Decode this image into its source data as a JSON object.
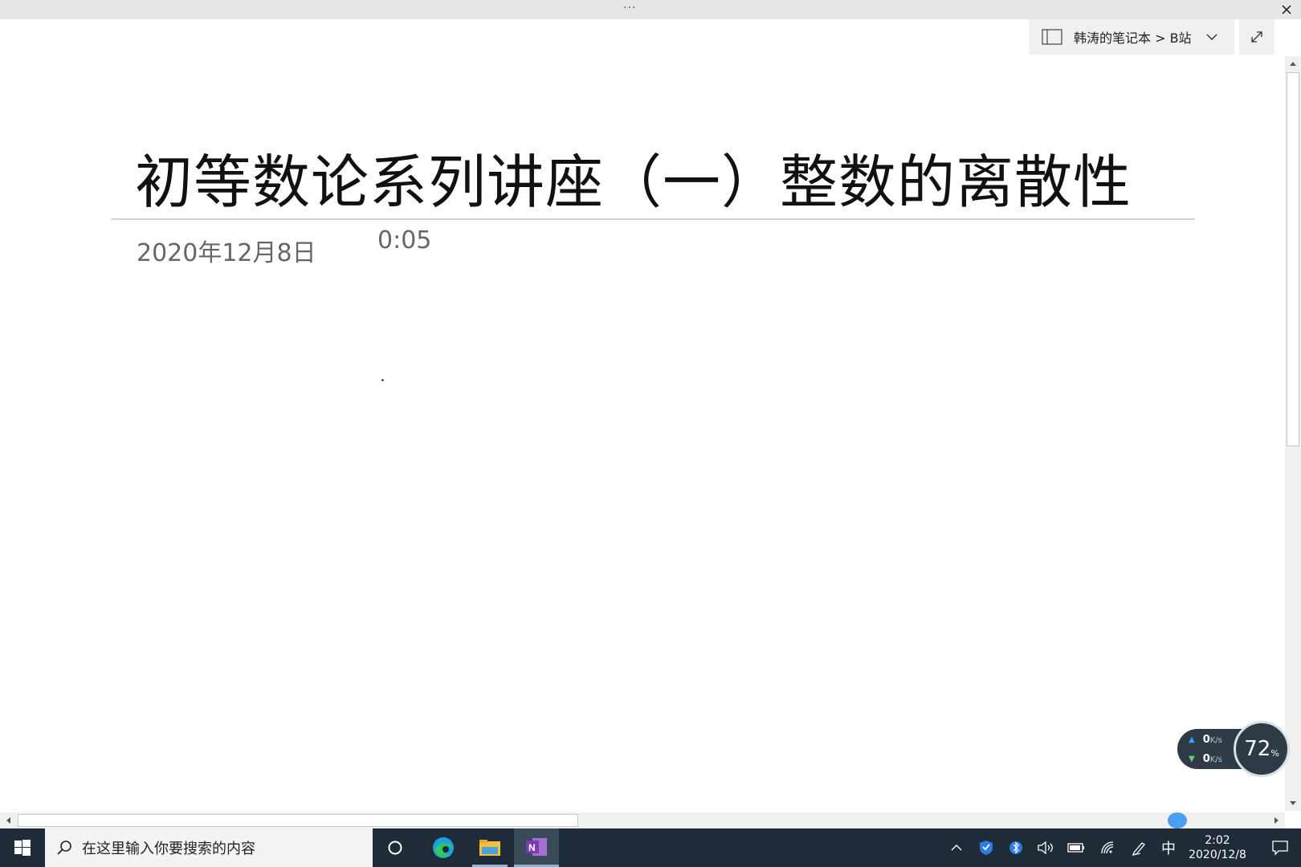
{
  "window": {
    "more_glyph": "···",
    "close_glyph": "✕"
  },
  "breadcrumb": {
    "text": "韩涛的笔记本 > B站"
  },
  "page": {
    "title": "初等数论系列讲座（一）整数的离散性",
    "date": "2020年12月8日",
    "time": "0:05"
  },
  "net_widget": {
    "upload_value": "0",
    "upload_unit": "K/s",
    "download_value": "0",
    "download_unit": "K/s",
    "cpu_value": "72",
    "cpu_unit": "%"
  },
  "taskbar": {
    "search_placeholder": "在这里输入你要搜索的内容",
    "apps": [
      "cortana-icon",
      "edge-icon",
      "file-explorer-icon",
      "onenote-icon"
    ],
    "ime": "中",
    "clock_time": "2:02",
    "clock_date": "2020/12/8"
  },
  "colors": {
    "taskbar_bg": "#1f2b36",
    "accent_blue": "#3a9bff",
    "onenote_purple": "#7a3bb5"
  }
}
